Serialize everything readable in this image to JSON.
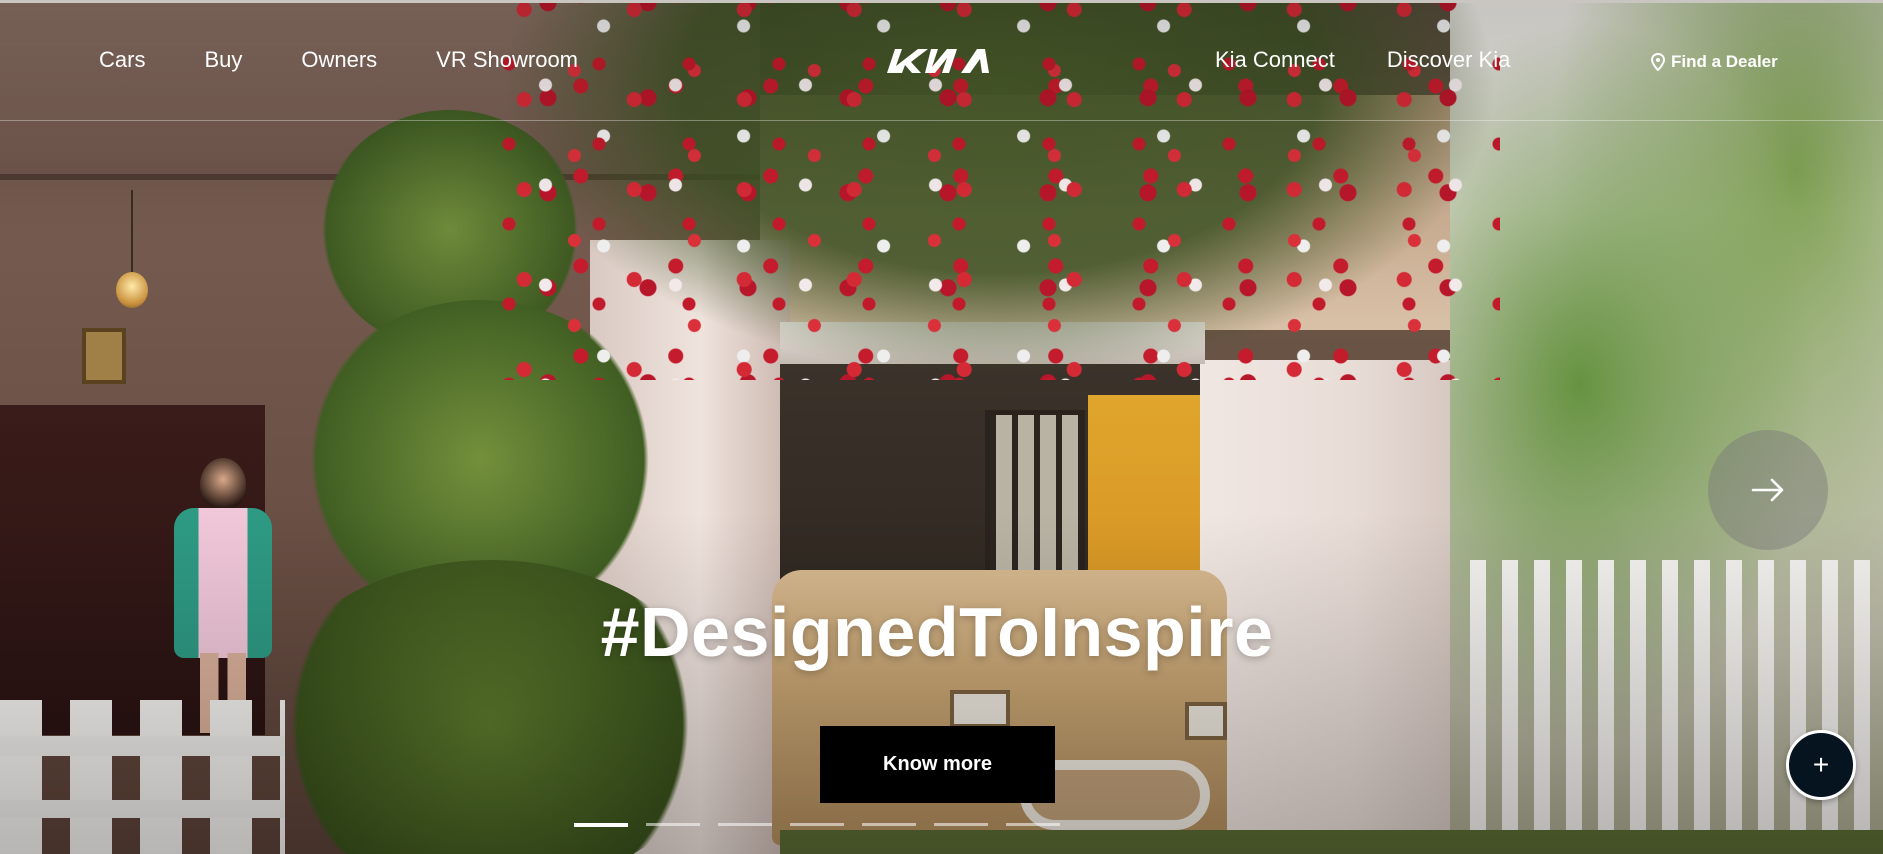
{
  "header": {
    "nav_left": [
      {
        "label": "Cars"
      },
      {
        "label": "Buy"
      },
      {
        "label": "Owners"
      },
      {
        "label": "VR Showroom"
      }
    ],
    "logo_text": "KIA",
    "nav_right": [
      {
        "label": "Kia Connect"
      },
      {
        "label": "Discover Kia"
      }
    ],
    "dealer": {
      "label": "Find a Dealer",
      "icon": "location-pin-icon"
    }
  },
  "hero": {
    "headline": "#DesignedToInspire",
    "cta_label": "Know more",
    "next_icon": "arrow-right-icon",
    "fab_label": "+",
    "slides_total": 7,
    "active_slide": 1
  },
  "colors": {
    "cta_background": "#000000",
    "fab_background": "#05141f",
    "text": "#ffffff"
  }
}
